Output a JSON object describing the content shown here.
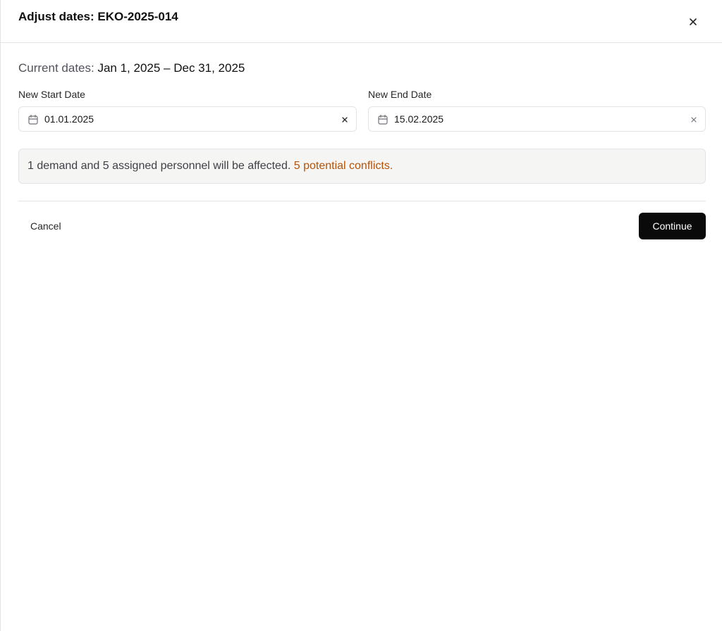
{
  "dialog": {
    "title": "Adjust dates: EKO-2025-014",
    "close_icon": "close-icon"
  },
  "current_dates": {
    "label": "Current dates:",
    "range": "Jan 1, 2025 – Dec 31, 2025"
  },
  "start_date": {
    "label": "New Start Date",
    "value": "01.01.2025",
    "icon": "calendar-icon",
    "clear_icon": "clear-icon"
  },
  "end_date": {
    "label": "New End Date",
    "value": "15.02.2025",
    "icon": "calendar-icon",
    "clear_icon": "clear-icon"
  },
  "notice": {
    "text": "1 demand and 5 assigned personnel will be affected.",
    "conflicts": "5 potential conflicts.",
    "conflict_color": "#b45309"
  },
  "footer": {
    "cancel_label": "Cancel",
    "continue_label": "Continue"
  },
  "colors": {
    "primary_button": "#0a0a0a",
    "border": "#e4e4e7",
    "notice_bg": "#f5f5f4"
  }
}
